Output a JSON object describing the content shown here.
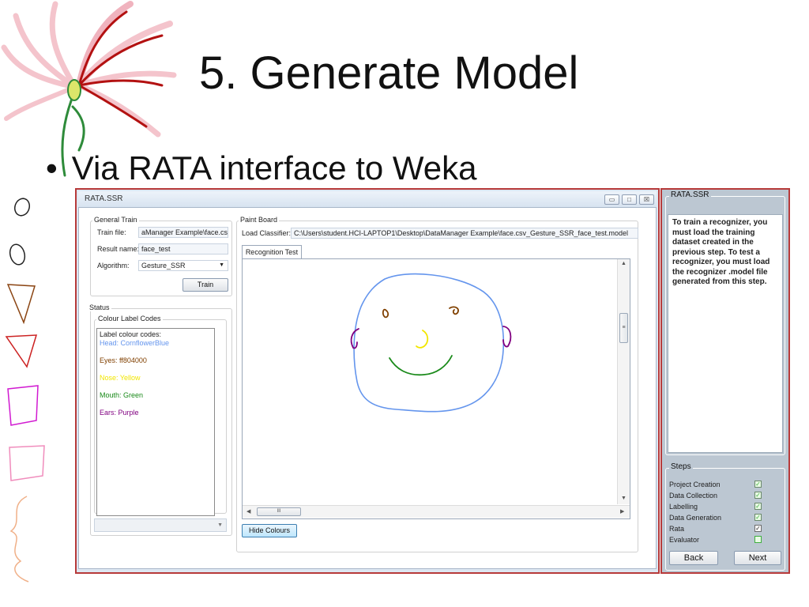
{
  "slide": {
    "title": "5. Generate Model",
    "bullet": "Via RATA interface to Weka"
  },
  "window": {
    "title": "RATA.SSR",
    "controls": {
      "minimize": "▭",
      "maximize": "□",
      "close": "☒"
    }
  },
  "general_train": {
    "title": "General Train",
    "train_file_label": "Train file:",
    "train_file_value": "aManager Example\\face.csv",
    "result_name_label": "Result name:",
    "result_name_value": "face_test",
    "algorithm_label": "Algorithm:",
    "algorithm_value": "Gesture_SSR",
    "train_button": "Train"
  },
  "status": {
    "title": "Status",
    "colour_title": "Colour Label Codes",
    "lines": [
      {
        "text": "Label colour codes:",
        "color": "#222222"
      },
      {
        "text": "Head: CornflowerBlue",
        "color": "#6495ed"
      },
      {
        "text": "",
        "color": "#222222"
      },
      {
        "text": "Eyes: ff804000",
        "color": "#804000"
      },
      {
        "text": "",
        "color": "#222222"
      },
      {
        "text": "Nose: Yellow",
        "color": "#f2e600"
      },
      {
        "text": "",
        "color": "#222222"
      },
      {
        "text": "Mouth: Green",
        "color": "#1a8a1a"
      },
      {
        "text": "",
        "color": "#222222"
      },
      {
        "text": "Ears: Purple",
        "color": "#800080"
      }
    ]
  },
  "paint_board": {
    "title": "Paint Board",
    "load_classifier_label": "Load Classifier:",
    "load_classifier_value": "C:\\Users\\student.HCI-LAPTOP1\\Desktop\\DataManager Example\\face.csv_Gesture_SSR_face_test.model",
    "tab": "Recognition Test",
    "hide_colours_button": "Hide Colours",
    "hscroll_grip": "III",
    "vscroll_grip": "≡"
  },
  "side_panel": {
    "title": "RATA.SSR",
    "instructions": "To train a recognizer, you must load the training dataset created in the previous step. To test a recognizer, you must load the recognizer .model file generated from this step.",
    "steps_title": "Steps",
    "steps": [
      {
        "label": "Project Creation",
        "checked": true
      },
      {
        "label": "Data Collection",
        "checked": true
      },
      {
        "label": "Labelling",
        "checked": true
      },
      {
        "label": "Data Generation",
        "checked": true
      },
      {
        "label": "Rata",
        "checked": true
      },
      {
        "label": "Evaluator",
        "checked": false
      }
    ],
    "back_button": "Back",
    "next_button": "Next"
  },
  "colors": {
    "frame_border": "#b73a3a",
    "head": "#6495ed",
    "eyes": "#804000",
    "nose": "#f2e600",
    "mouth": "#1a8a1a",
    "ears": "#800080",
    "check": "#3fae3f"
  }
}
